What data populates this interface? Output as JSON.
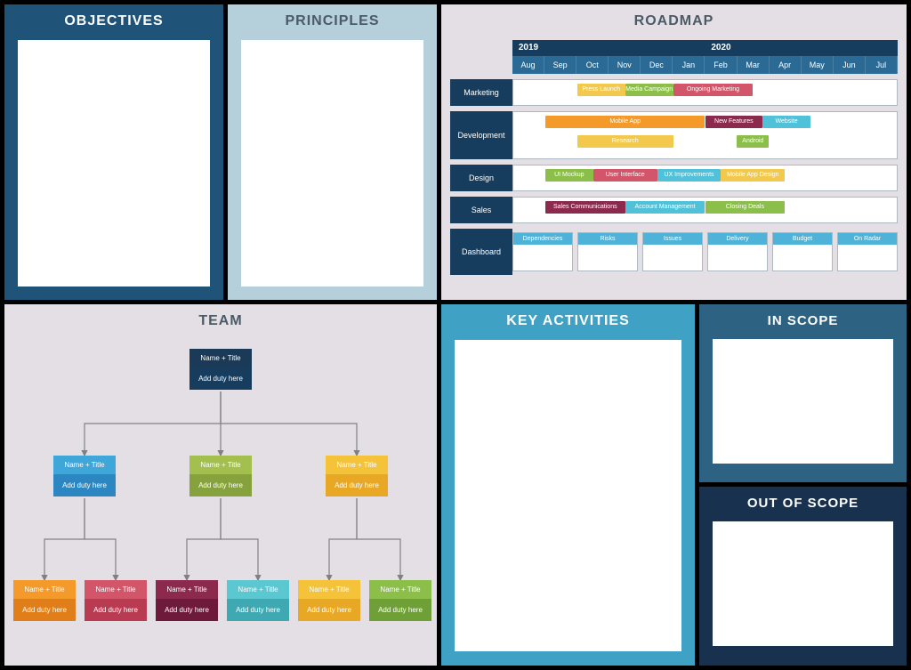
{
  "panels": {
    "objectives": "OBJECTIVES",
    "principles": "PRINCIPLES",
    "roadmap": "ROADMAP",
    "team": "TEAM",
    "key_activities": "KEY ACTIVITIES",
    "in_scope": "IN SCOPE",
    "out_of_scope": "OUT OF SCOPE"
  },
  "roadmap": {
    "years": [
      "2019",
      "2020"
    ],
    "months": [
      "Aug",
      "Sep",
      "Oct",
      "Nov",
      "Dec",
      "Jan",
      "Feb",
      "Mar",
      "Apr",
      "May",
      "Jun",
      "Jul"
    ],
    "rows": [
      {
        "label": "Marketing",
        "bars": [
          {
            "label": "Press Launch",
            "start": 2,
            "span": 1.5,
            "color": "#f2c94c",
            "row": 0
          },
          {
            "label": "Media Campaign",
            "start": 3.5,
            "span": 1.5,
            "color": "#8bbf4a",
            "row": 0
          },
          {
            "label": "Ongoing Marketing",
            "start": 5,
            "span": 2.5,
            "color": "#d2556a",
            "row": 0
          }
        ]
      },
      {
        "label": "Development",
        "bars": [
          {
            "label": "Mobile App",
            "start": 1,
            "span": 5,
            "color": "#f39a2b",
            "row": 0
          },
          {
            "label": "New Features",
            "start": 6,
            "span": 1.8,
            "color": "#8c2a4e",
            "row": 0
          },
          {
            "label": "Website",
            "start": 7.8,
            "span": 1.5,
            "color": "#4fc1d9",
            "row": 0
          },
          {
            "label": "Research",
            "start": 2,
            "span": 3,
            "color": "#f2c94c",
            "row": 1
          },
          {
            "label": "Android",
            "start": 7,
            "span": 1,
            "color": "#8bbf4a",
            "row": 1
          }
        ]
      },
      {
        "label": "Design",
        "bars": [
          {
            "label": "UI Mockup",
            "start": 1,
            "span": 1.5,
            "color": "#8bbf4a",
            "row": 0
          },
          {
            "label": "User Interface",
            "start": 2.5,
            "span": 2,
            "color": "#d2556a",
            "row": 0
          },
          {
            "label": "UX Improvements",
            "start": 4.5,
            "span": 2,
            "color": "#4fc1d9",
            "row": 0
          },
          {
            "label": "Mobile App Design",
            "start": 6.5,
            "span": 2,
            "color": "#f2c94c",
            "row": 0
          }
        ]
      },
      {
        "label": "Sales",
        "bars": [
          {
            "label": "Sales Communications",
            "start": 1,
            "span": 2.5,
            "color": "#8c2a4e",
            "row": 0
          },
          {
            "label": "Account Management",
            "start": 3.5,
            "span": 2.5,
            "color": "#4fc1d9",
            "row": 0
          },
          {
            "label": "Closing Deals",
            "start": 6,
            "span": 2.5,
            "color": "#8bbf4a",
            "row": 0
          }
        ]
      }
    ],
    "dashboard": {
      "label": "Dashboard",
      "cards": [
        "Dependencies",
        "Risks",
        "Issues",
        "Delivery",
        "Budget",
        "On Radar"
      ]
    }
  },
  "team": {
    "root": {
      "title": "Name + Title",
      "duty": "Add duty here"
    },
    "level2": [
      {
        "title": "Name + Title",
        "duty": "Add duty here",
        "colors": [
          "#3ea6d9",
          "#2c86c2"
        ]
      },
      {
        "title": "Name + Title",
        "duty": "Add duty here",
        "colors": [
          "#a3c04e",
          "#86a23d"
        ]
      },
      {
        "title": "Name + Title",
        "duty": "Add duty here",
        "colors": [
          "#f4c33a",
          "#e8a825"
        ]
      }
    ],
    "level3": [
      {
        "title": "Name + Title",
        "duty": "Add duty here",
        "colors": [
          "#f39a2b",
          "#e07f1a"
        ]
      },
      {
        "title": "Name + Title",
        "duty": "Add duty here",
        "colors": [
          "#d2556a",
          "#b83b52"
        ]
      },
      {
        "title": "Name + Title",
        "duty": "Add duty here",
        "colors": [
          "#8c2a4e",
          "#6e1b3b"
        ]
      },
      {
        "title": "Name + Title",
        "duty": "Add duty here",
        "colors": [
          "#5bc7d1",
          "#3fa9b3"
        ]
      },
      {
        "title": "Name + Title",
        "duty": "Add duty here",
        "colors": [
          "#f4c33a",
          "#e8a825"
        ]
      },
      {
        "title": "Name + Title",
        "duty": "Add duty here",
        "colors": [
          "#8bbf4a",
          "#6fa038"
        ]
      }
    ]
  }
}
